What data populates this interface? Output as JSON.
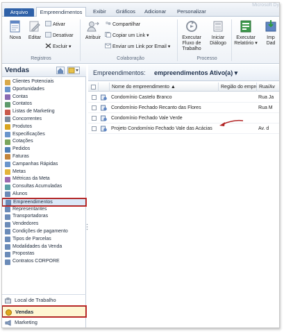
{
  "tabs": {
    "file": "Arquivo",
    "items": [
      "Empreendimentos",
      "Exibir",
      "Gráficos",
      "Adicionar",
      "Personalizar"
    ],
    "logo": "Microsoft Dy"
  },
  "ribbon": {
    "registros": {
      "group_label": "Registros",
      "nova": "Nova",
      "editar": "Editar",
      "ativar": "Ativar",
      "desativar": "Desativar",
      "excluir": "Excluir"
    },
    "colaboracao": {
      "group_label": "Colaboração",
      "atribuir": "Atribuir",
      "compartilhar": "Compartilhar",
      "copiar_link": "Copiar um Link",
      "enviar_link": "Enviar um Link por Email"
    },
    "processo": {
      "group_label": "Processo",
      "executar_fluxo_1": "Executar Fluxo de",
      "executar_fluxo_2": "Trabalho",
      "iniciar_dialogo_1": "Iniciar",
      "iniciar_dialogo_2": "Diálogo"
    },
    "extra": {
      "executar_relatorio_1": "Executar",
      "executar_relatorio_2": "Relatório",
      "importar_1": "Imp",
      "importar_2": "Dad"
    }
  },
  "nav": {
    "title": "Vendas",
    "items": [
      "Clientes Potenciais",
      "Oportunidades",
      "Contas",
      "Contatos",
      "Listas de Marketing",
      "Concorrentes",
      "Produtos",
      "Especificações",
      "Cotações",
      "Pedidos",
      "Faturas",
      "Campanhas Rápidas",
      "Metas",
      "Métricas da Meta",
      "Consultas Acumuladas",
      "Alunos",
      "Empreendimentos",
      "Representantes",
      "Transportadoras",
      "Vendedores",
      "Condições de pagamento",
      "Tipos de Parcelas",
      "Modalidades da Venda",
      "Propostas",
      "Contratos CORPORE"
    ],
    "selected_index": 16,
    "bottom": [
      "Local de Trabalho",
      "Vendas",
      "Marketing"
    ]
  },
  "view": {
    "label": "Empreendimentos:",
    "name": "empreendimentos Ativo(a) ▾"
  },
  "grid": {
    "columns": [
      "Nome do empreendimento ▲",
      "Região do empre...",
      "Rua/Av"
    ],
    "rows": [
      {
        "name": "Condomínio Castelo Branco",
        "city": "Rua Ja"
      },
      {
        "name": "Condomínio Fechado Recanto das Flores",
        "city": "Rua M"
      },
      {
        "name": "Condomínio Fechado Vale Verde",
        "city": ""
      },
      {
        "name": "Projeto Condomínio Fechado Vale das Acácias",
        "city": "Av. d"
      }
    ]
  },
  "colors": {
    "accent": "#2f61a8",
    "highlight_border": "#b22222",
    "arrow": "#b22222"
  }
}
